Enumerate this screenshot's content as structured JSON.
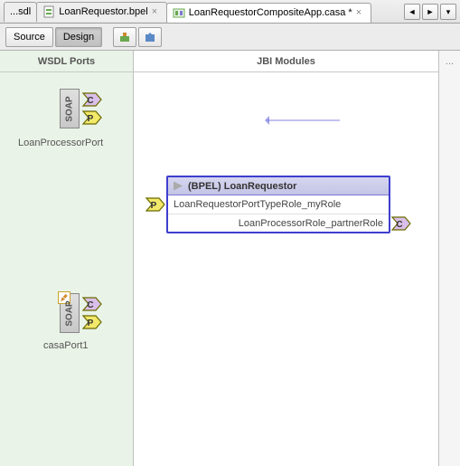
{
  "tabs": {
    "t0": "...sdl",
    "t1": "LoanRequestor.bpel",
    "t2": "LoanRequestorCompositeApp.casa *"
  },
  "toolbar": {
    "source": "Source",
    "design": "Design"
  },
  "columns": {
    "wsdl": "WSDL Ports",
    "jbi": "JBI Modules",
    "ext": "..."
  },
  "ports": {
    "soap": "SOAP",
    "p1_label": "LoanProcessorPort",
    "p2_label": "casaPort1"
  },
  "module": {
    "title": "(BPEL) LoanRequestor",
    "row1": "LoanRequestorPortTypeRole_myRole",
    "row2": "LoanProcessorRole_partnerRole"
  },
  "glyph": {
    "c": "C",
    "p": "P"
  }
}
